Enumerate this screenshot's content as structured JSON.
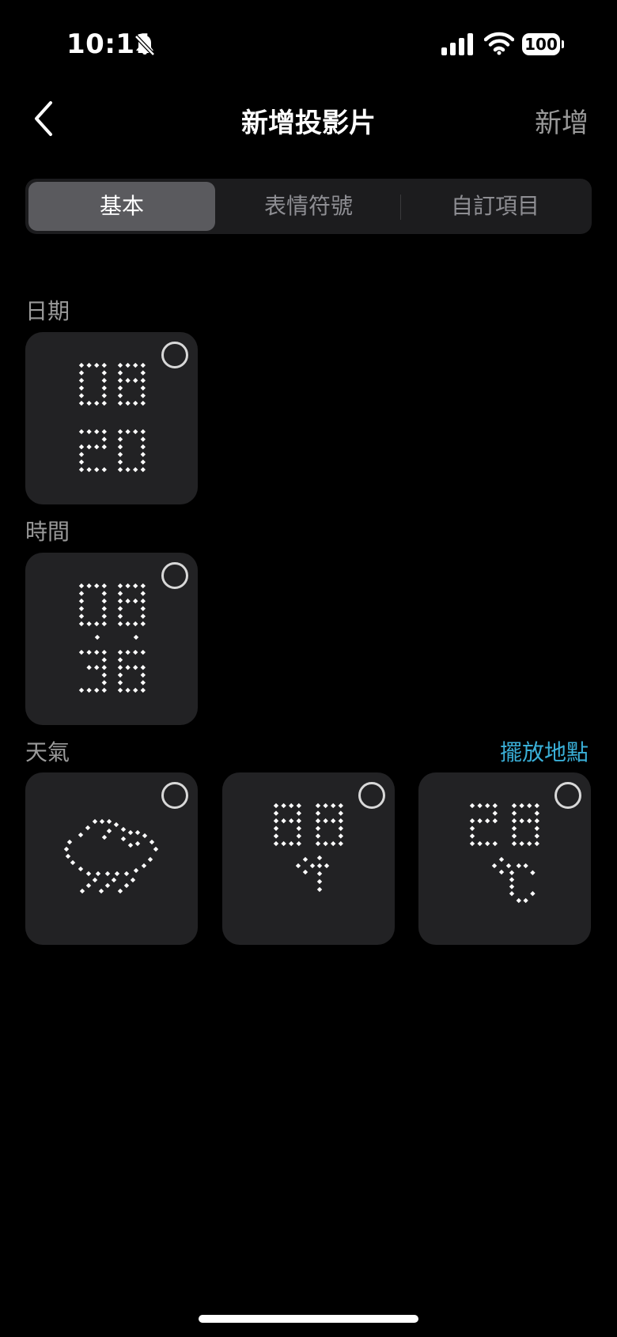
{
  "status_bar": {
    "time": "10:11",
    "battery": "100",
    "icons": [
      "bell-slash-icon",
      "signal-icon",
      "wifi-icon",
      "battery-icon"
    ]
  },
  "nav": {
    "title": "新增投影片",
    "add_label": "新增",
    "back_icon": "chevron-left-icon"
  },
  "tabs": [
    {
      "label": "基本",
      "active": true
    },
    {
      "label": "表情符號",
      "active": false
    },
    {
      "label": "自訂項目",
      "active": false
    }
  ],
  "sections": {
    "date": {
      "label": "日期"
    },
    "time": {
      "label": "時間"
    },
    "weather": {
      "label": "天氣",
      "action": "擺放地點"
    }
  },
  "tiles": {
    "date": [
      {
        "icon": "dot-matrix-date-icon",
        "selected": false
      }
    ],
    "time": [
      {
        "icon": "dot-matrix-time-icon",
        "selected": false
      }
    ],
    "weather": [
      {
        "icon": "dot-matrix-rain-cloud-icon",
        "selected": false
      },
      {
        "icon": "dot-matrix-temperature-icon",
        "selected": false
      },
      {
        "icon": "dot-matrix-celsius-icon",
        "selected": false
      }
    ]
  },
  "colors": {
    "background": "#000000",
    "tile": "#222224",
    "accent": "#3ab0d8",
    "secondary_text": "#9a9a9a"
  }
}
